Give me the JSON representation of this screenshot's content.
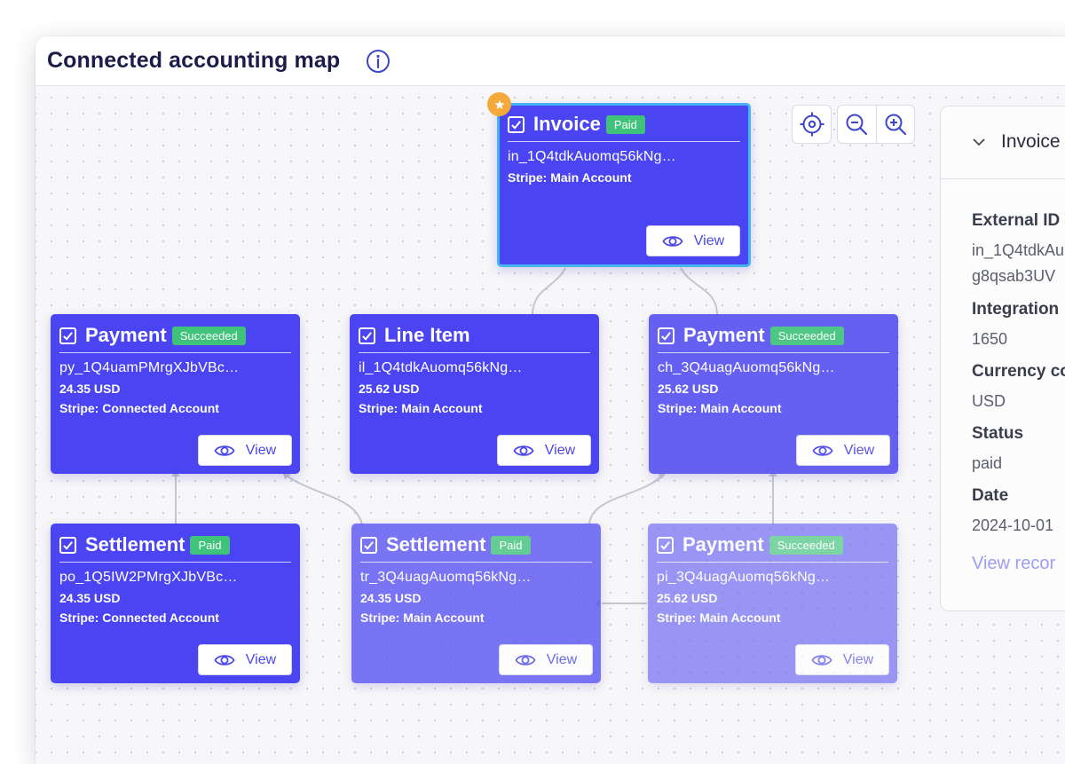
{
  "header": {
    "title": "Connected accounting map"
  },
  "view_label": "View",
  "nodes": {
    "invoice": {
      "type": "Invoice",
      "badge": "Paid",
      "id": "in_1Q4tdkAuomq56kNg…",
      "account": "Stripe: Main Account",
      "color": "#4a44f2"
    },
    "payment1": {
      "type": "Payment",
      "badge": "Succeeded",
      "id": "py_1Q4uamPMrgXJbVBc…",
      "amount": "24.35 USD",
      "account": "Stripe: Connected Account",
      "color": "#4a44f2"
    },
    "lineitem": {
      "type": "Line Item",
      "id": "il_1Q4tdkAuomq56kNg…",
      "amount": "25.62 USD",
      "account": "Stripe: Main Account",
      "color": "#4a44f2"
    },
    "payment2": {
      "type": "Payment",
      "badge": "Succeeded",
      "id": "ch_3Q4uagAuomq56kNg…",
      "amount": "25.62 USD",
      "account": "Stripe: Main Account",
      "color": "#5a54f2"
    },
    "settlement1": {
      "type": "Settlement",
      "badge": "Paid",
      "id": "po_1Q5IW2PMrgXJbVBc…",
      "amount": "24.35 USD",
      "account": "Stripe: Connected Account",
      "color": "#4a44f2"
    },
    "settlement2": {
      "type": "Settlement",
      "badge": "Paid",
      "id": "tr_3Q4uagAuomq56kNg…",
      "amount": "24.35 USD",
      "account": "Stripe: Main Account",
      "color": "#5a54f2"
    },
    "payment3": {
      "type": "Payment",
      "badge": "Succeeded",
      "id": "pi_3Q4uagAuomq56kNg…",
      "amount": "25.62 USD",
      "account": "Stripe: Main Account",
      "color": "#6a64f2"
    }
  },
  "panel": {
    "title": "Invoice",
    "fields": [
      {
        "label": "External ID",
        "value": "in_1Q4tdkAu",
        "value2": "g8qsab3UV"
      },
      {
        "label": "Integration",
        "value": "1650"
      },
      {
        "label": "Currency co",
        "value": "USD"
      },
      {
        "label": "Status",
        "value": "paid"
      },
      {
        "label": "Date",
        "value": "2024-10-01"
      }
    ],
    "link": "View recor"
  },
  "colors": {
    "accent": "#4a44f2",
    "badge_green": "#3fc37a",
    "selected_border": "#45b4f0",
    "star": "#f5a93a"
  }
}
